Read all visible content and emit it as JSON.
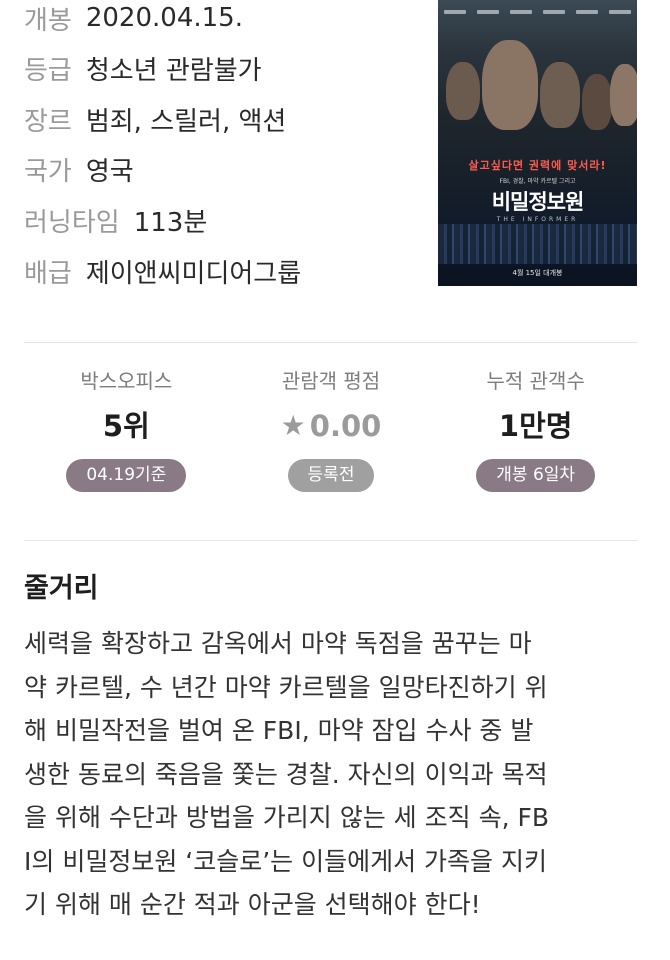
{
  "info": {
    "rows": [
      {
        "label": "개봉",
        "value": "2020.04.15."
      },
      {
        "label": "등급",
        "value": "청소년 관람불가"
      },
      {
        "label": "장르",
        "value": "범죄, 스릴러, 액션"
      },
      {
        "label": "국가",
        "value": "영국"
      },
      {
        "label": "러닝타임",
        "value": "113분"
      },
      {
        "label": "배급",
        "value": "제이앤씨미디어그룹"
      }
    ]
  },
  "poster": {
    "tagline": "살고싶다면 권력에 맞서라!",
    "subtitle": "FBI, 경찰, 마약 카르텔 그리고",
    "title": "비밀정보원",
    "title_en": "THE INFORMER",
    "release_note": "4월 15일 대개봉"
  },
  "stats": [
    {
      "label": "박스오피스",
      "value": "5위",
      "badge": "04.19기준"
    },
    {
      "label": "관람객 평점",
      "value": "0.00",
      "icon": "star-icon",
      "badge": "등록전"
    },
    {
      "label": "누적 관객수",
      "value": "1만명",
      "badge": "개봉 6일차"
    }
  ],
  "synopsis": {
    "title": "줄거리",
    "lines": [
      "세력을 확장하고 감옥에서 마약 독점을 꿈꾸는 마",
      "약 카르텔, 수 년간 마약 카르텔을 일망타진하기 위",
      "해 비밀작전을 벌여 온 FBI, 마약 잠입 수사 중 발",
      "생한 동료의 죽음을 쫓는 경찰. 자신의 이익과 목적",
      "을 위해 수단과 방법을 가리지 않는 세 조직 속, FB",
      "I의 비밀정보원 ‘코슬로’는 이들에게서 가족을 지키",
      "기 위해 매 순간 적과 아군을 선택해야 한다!"
    ]
  },
  "colors": {
    "badge": "#8a7a86",
    "badge_grey": "#a0a0a0",
    "label": "#9a9a9a"
  }
}
